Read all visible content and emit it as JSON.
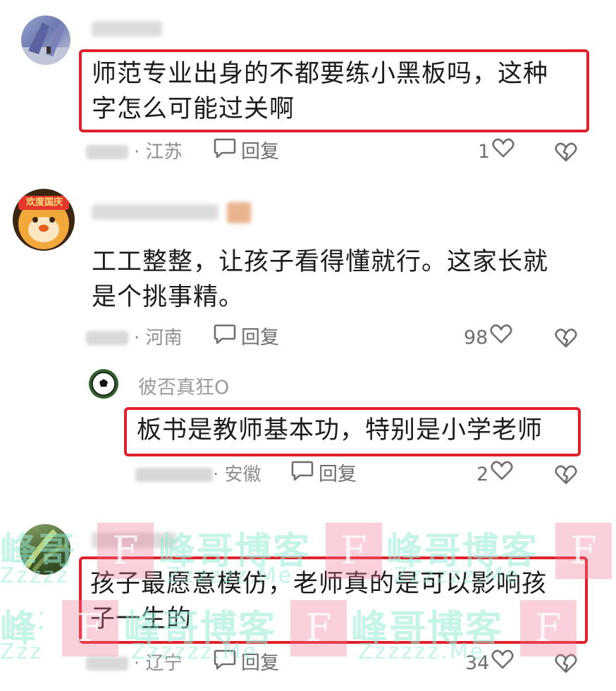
{
  "comments": [
    {
      "text_line1": "师范专业出身的不都要练小黑板吗，这种",
      "text_line2": "字怎么可能过关啊",
      "location": "· 江苏",
      "reply_label": "回复",
      "likes": "1"
    },
    {
      "text_line1": "工工整整，让孩子看得懂就行。这家长就",
      "text_line2": "是个挑事精。",
      "location": "· 河南",
      "reply_label": "回复",
      "likes": "98",
      "avatar_badge": "欢度国庆"
    },
    {
      "username": "彼否真狂O",
      "text_line1": "板书是教师基本功，特别是小学老师",
      "location": "· 安徽",
      "reply_label": "回复",
      "likes": "2"
    },
    {
      "text_line1": "孩子最愿意模仿，老师真的是可以影响孩",
      "text_line2": "子一生的",
      "location": "· 辽宁",
      "reply_label": "回复",
      "likes": "34"
    }
  ],
  "watermark": {
    "main": "峰哥博客",
    "sub": "Zzzzzz.Me",
    "letter": "F"
  },
  "colors": {
    "highlight": "#e0202a",
    "meta_text": "#8e8e8e",
    "watermark_green": "#96ebd7",
    "watermark_pink": "#f07896"
  },
  "icons": [
    "comment-bubble-icon",
    "heart-icon",
    "broken-heart-icon"
  ]
}
